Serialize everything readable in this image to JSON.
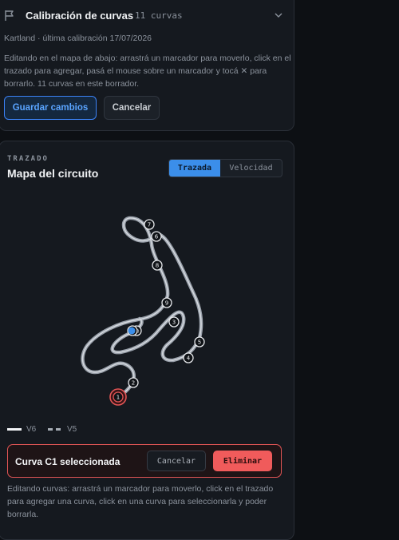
{
  "calibration": {
    "title": "Calibración de curvas",
    "curve_count": "11 curvas",
    "subtitle": "Kartland · última calibración 17/07/2026",
    "help": "Editando en el mapa de abajo: arrastrá un marcador para moverlo, click en el trazado para agregar, pasá el mouse sobre un marcador y tocá ✕ para borrarlo. 11 curvas en este borrador.",
    "save_label": "Guardar cambios",
    "cancel_label": "Cancelar"
  },
  "map": {
    "eyebrow": "TRAZADO",
    "title": "Mapa del circuito",
    "tabs": [
      {
        "label": "Trazada",
        "active": true
      },
      {
        "label": "Velocidad",
        "active": false
      }
    ],
    "markers": [
      "1",
      "2",
      "3",
      "4",
      "5",
      "6",
      "7",
      "8",
      "9",
      "10",
      "11"
    ],
    "selected_marker": "1",
    "legend": [
      {
        "label": "V6",
        "style": "solid"
      },
      {
        "label": "V5",
        "style": "dashed"
      }
    ],
    "colors": {
      "track": "#9aa1ab",
      "selected": "#e25555",
      "current_position": "#3b8eea"
    }
  },
  "selection": {
    "label": "Curva C1 seleccionada",
    "cancel_label": "Cancelar",
    "delete_label": "Eliminar"
  },
  "edit_help": "Editando curvas: arrastrá un marcador para moverlo, click en el trazado para agregar una curva, click en una curva para seleccionarla y poder borrarla."
}
